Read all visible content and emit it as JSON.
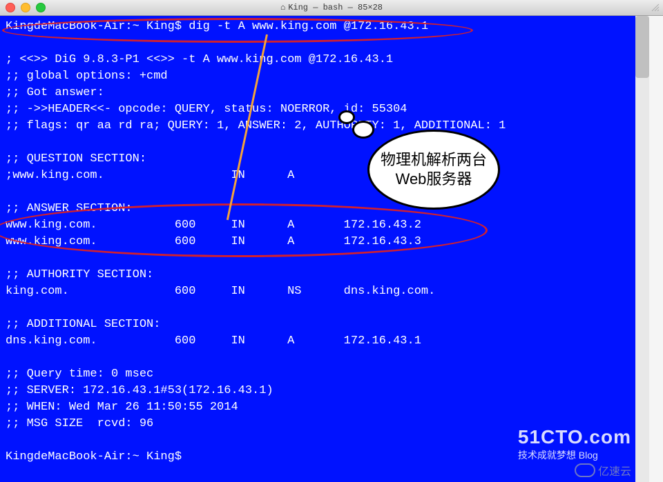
{
  "window": {
    "title": "King — bash — 85×28",
    "home_icon": "⌂"
  },
  "terminal": {
    "prompt": "KingdeMacBook-Air:~ King$",
    "command": "dig -t A www.king.com @172.16.43.1",
    "lines": {
      "l1": "KingdeMacBook-Air:~ King$ dig -t A www.king.com @172.16.43.1",
      "l2": "",
      "l3": "; <<>> DiG 9.8.3-P1 <<>> -t A www.king.com @172.16.43.1",
      "l4": ";; global options: +cmd",
      "l5": ";; Got answer:",
      "l6": ";; ->>HEADER<<- opcode: QUERY, status: NOERROR, id: 55304",
      "l7": ";; flags: qr aa rd ra; QUERY: 1, ANSWER: 2, AUTHORITY: 1, ADDITIONAL: 1",
      "l8": "",
      "l9": ";; QUESTION SECTION:",
      "l10": ";www.king.com.                  IN      A",
      "l11": "",
      "l12": ";; ANSWER SECTION:",
      "l13": "www.king.com.           600     IN      A       172.16.43.2",
      "l14": "www.king.com.           600     IN      A       172.16.43.3",
      "l15": "",
      "l16": ";; AUTHORITY SECTION:",
      "l17": "king.com.               600     IN      NS      dns.king.com.",
      "l18": "",
      "l19": ";; ADDITIONAL SECTION:",
      "l20": "dns.king.com.           600     IN      A       172.16.43.1",
      "l21": "",
      "l22": ";; Query time: 0 msec",
      "l23": ";; SERVER: 172.16.43.1#53(172.16.43.1)",
      "l24": ";; WHEN: Wed Mar 26 11:50:55 2014",
      "l25": ";; MSG SIZE  rcvd: 96",
      "l26": "",
      "l27": "KingdeMacBook-Air:~ King$ "
    }
  },
  "annotation": {
    "bubble_text": "物理机解析两台Web服务器"
  },
  "watermark": {
    "site1_big": "51CTO.com",
    "site1_small": "技术成就梦想  Blog",
    "site2": "亿速云"
  }
}
